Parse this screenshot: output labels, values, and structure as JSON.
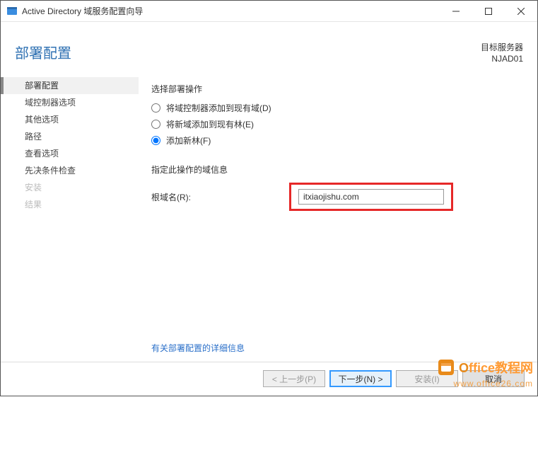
{
  "window": {
    "title": "Active Directory 域服务配置向导"
  },
  "header": {
    "page_title": "部署配置",
    "target_label": "目标服务器",
    "target_value": "NJAD01"
  },
  "sidebar": {
    "items": [
      {
        "label": "部署配置",
        "selected": true,
        "disabled": false
      },
      {
        "label": "域控制器选项",
        "selected": false,
        "disabled": false
      },
      {
        "label": "其他选项",
        "selected": false,
        "disabled": false
      },
      {
        "label": "路径",
        "selected": false,
        "disabled": false
      },
      {
        "label": "查看选项",
        "selected": false,
        "disabled": false
      },
      {
        "label": "先决条件检查",
        "selected": false,
        "disabled": false
      },
      {
        "label": "安装",
        "selected": false,
        "disabled": true
      },
      {
        "label": "结果",
        "selected": false,
        "disabled": true
      }
    ]
  },
  "content": {
    "select_op_label": "选择部署操作",
    "radios": [
      {
        "label": "将域控制器添加到现有域(D)",
        "checked": false
      },
      {
        "label": "将新域添加到现有林(E)",
        "checked": false
      },
      {
        "label": "添加新林(F)",
        "checked": true
      }
    ],
    "domain_info_label": "指定此操作的域信息",
    "root_domain_label": "根域名(R):",
    "root_domain_value": "itxiaojishu.com",
    "more_link": "有关部署配置的详细信息"
  },
  "buttons": {
    "prev": "< 上一步(P)",
    "next": "下一步(N) >",
    "install": "安装(I)",
    "cancel": "取消"
  },
  "watermark": {
    "line1_a": "O",
    "line1_b": "ffice教程网",
    "line2": "www.office26.com"
  }
}
